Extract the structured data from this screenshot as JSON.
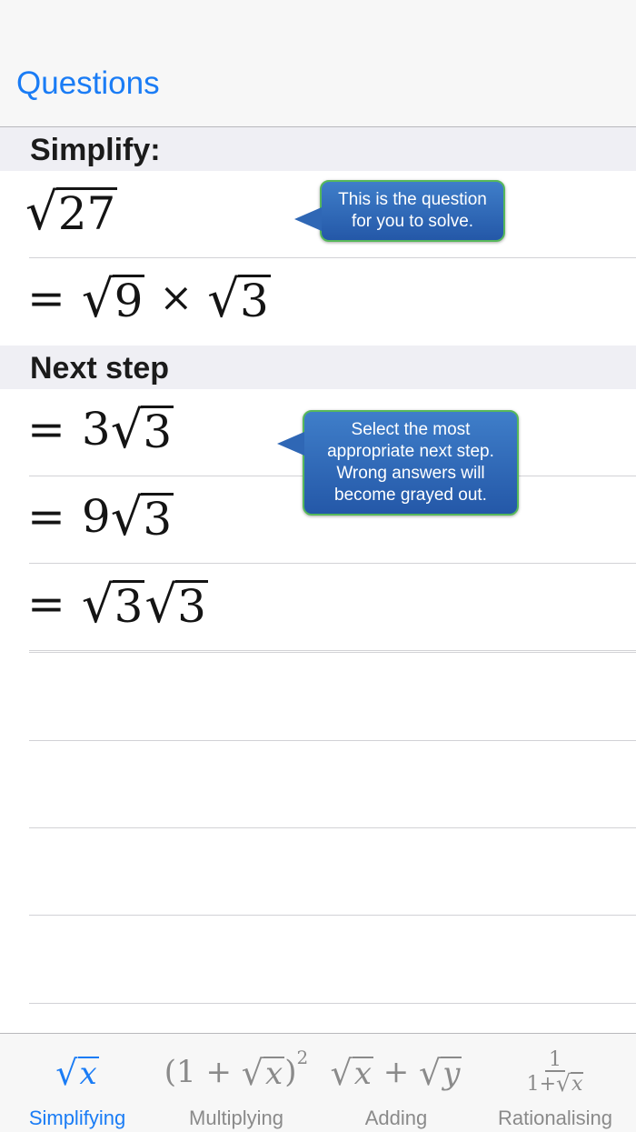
{
  "nav": {
    "back_label": "Questions"
  },
  "question": {
    "header": "Simplify:",
    "expression": {
      "radicand": "27"
    },
    "working": {
      "equals": "=",
      "radicand_a": "9",
      "times": "×",
      "radicand_b": "3"
    }
  },
  "next_step": {
    "header": "Next step",
    "options": [
      {
        "equals": "=",
        "coef": "3",
        "radicand": "3"
      },
      {
        "equals": "=",
        "coef": "9",
        "radicand": "3"
      },
      {
        "equals": "=",
        "radicand_a": "3",
        "radicand_b": "3"
      }
    ]
  },
  "callouts": {
    "question": {
      "line1": "This is the question",
      "line2": "for you to solve."
    },
    "next_step": {
      "line1": "Select the most",
      "line2": "appropriate next step.",
      "line3": "Wrong answers will",
      "line4": "become grayed out."
    }
  },
  "tabs": [
    {
      "label": "Simplifying",
      "icon": "sqrt-x-icon",
      "active": true
    },
    {
      "label": "Multiplying",
      "icon": "one-plus-sqrt-x-squared-icon",
      "active": false
    },
    {
      "label": "Adding",
      "icon": "sqrt-x-plus-sqrt-y-icon",
      "active": false
    },
    {
      "label": "Rationalising",
      "icon": "one-over-one-plus-sqrt-x-icon",
      "active": false
    }
  ],
  "colors": {
    "accent": "#1a7cf5",
    "callout_fill": "#2f67b5",
    "callout_border": "#57b85a",
    "section_bg": "#efeff4"
  }
}
